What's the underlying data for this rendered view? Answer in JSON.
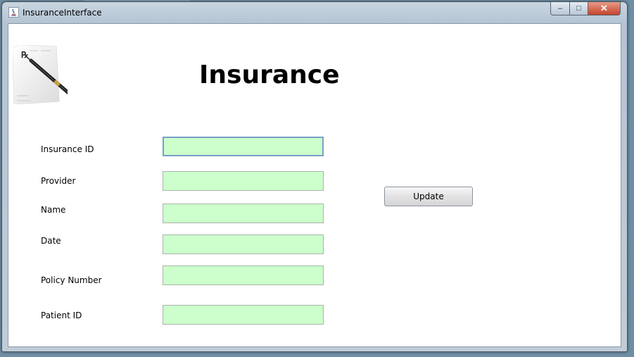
{
  "window": {
    "title": "InsuranceInterface",
    "controls": {
      "minimize": "–",
      "maximize": "□",
      "close": "✕"
    }
  },
  "header": {
    "title": "Insurance",
    "logo_icon": "prescription-pad-with-pen"
  },
  "form": {
    "fields": [
      {
        "label": "Insurance ID",
        "value": ""
      },
      {
        "label": "Provider",
        "value": ""
      },
      {
        "label": "Name",
        "value": ""
      },
      {
        "label": "Date",
        "value": ""
      },
      {
        "label": "Policy Number",
        "value": ""
      },
      {
        "label": "Patient ID",
        "value": ""
      }
    ],
    "field_color": "#ccffcc"
  },
  "actions": {
    "update_label": "Update"
  }
}
